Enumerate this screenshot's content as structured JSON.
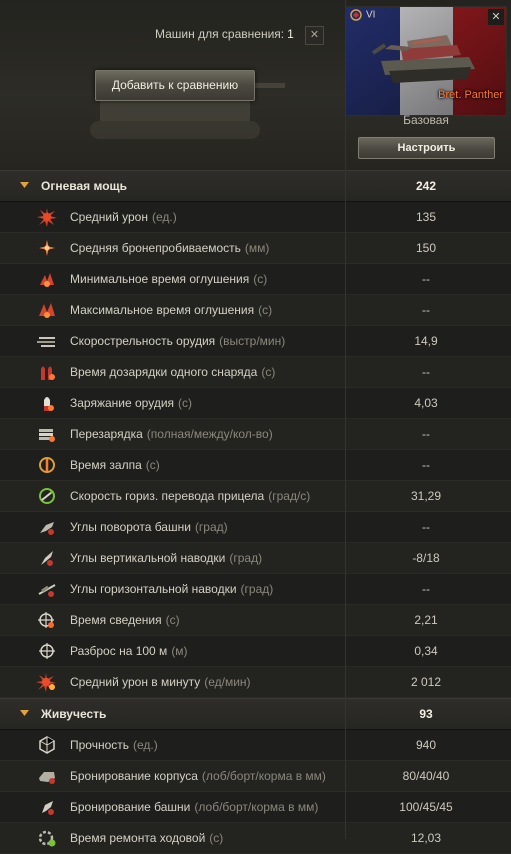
{
  "compare": {
    "count_label": "Машин для сравнения:",
    "count_value": "1",
    "add_button": "Добавить к сравнению"
  },
  "vehicle": {
    "tier": "VI",
    "name": "Bret. Panther",
    "config_label": "Базовая",
    "configure_button": "Настроить",
    "flag_colors": [
      "#28357a",
      "#e6e6ea",
      "#b21f25"
    ]
  },
  "sections": [
    {
      "title": "Огневая мощь",
      "value": "242",
      "rows": [
        {
          "icon": "damage-icon",
          "label": "Средний урон",
          "unit": "(ед.)",
          "value": "135"
        },
        {
          "icon": "penetration-icon",
          "label": "Средняя бронепробиваемость",
          "unit": "(мм)",
          "value": "150"
        },
        {
          "icon": "stun-min-icon",
          "label": "Минимальное время оглушения",
          "unit": "(с)",
          "value": "--"
        },
        {
          "icon": "stun-max-icon",
          "label": "Максимальное время оглушения",
          "unit": "(с)",
          "value": "--"
        },
        {
          "icon": "rate-of-fire-icon",
          "label": "Скорострельность орудия",
          "unit": "(выстр/мин)",
          "value": "14,9"
        },
        {
          "icon": "shell-reload-icon",
          "label": "Время дозарядки одного снаряда",
          "unit": "(с)",
          "value": "--"
        },
        {
          "icon": "reload-icon",
          "label": "Заряжание орудия",
          "unit": "(с)",
          "value": "4,03"
        },
        {
          "icon": "clip-reload-icon",
          "label": "Перезарядка",
          "unit": "(полная/между/кол-во)",
          "value": "--"
        },
        {
          "icon": "salvo-icon",
          "label": "Время залпа",
          "unit": "(с)",
          "value": "--"
        },
        {
          "icon": "traverse-speed-icon",
          "label": "Скорость гориз. перевода прицела",
          "unit": "(град/с)",
          "value": "31,29"
        },
        {
          "icon": "turret-rotation-icon",
          "label": "Углы поворота башни",
          "unit": "(град)",
          "value": "--"
        },
        {
          "icon": "gun-elevation-icon",
          "label": "Углы вертикальной наводки",
          "unit": "(град)",
          "value": "-8/18"
        },
        {
          "icon": "gun-traverse-icon",
          "label": "Углы горизонтальной наводки",
          "unit": "(град)",
          "value": "--"
        },
        {
          "icon": "aim-time-icon",
          "label": "Время сведения",
          "unit": "(с)",
          "value": "2,21"
        },
        {
          "icon": "dispersion-icon",
          "label": "Разброс на 100 м",
          "unit": "(м)",
          "value": "0,34"
        },
        {
          "icon": "dpm-icon",
          "label": "Средний урон в минуту",
          "unit": "(ед/мин)",
          "value": "2 012"
        }
      ]
    },
    {
      "title": "Живучесть",
      "value": "93",
      "rows": [
        {
          "icon": "hit-points-icon",
          "label": "Прочность",
          "unit": "(ед.)",
          "value": "940"
        },
        {
          "icon": "hull-armor-icon",
          "label": "Бронирование корпуса",
          "unit": "(лоб/борт/корма в мм)",
          "value": "80/40/40"
        },
        {
          "icon": "turret-armor-icon",
          "label": "Бронирование башни",
          "unit": "(лоб/борт/корма в мм)",
          "value": "100/45/45"
        },
        {
          "icon": "track-repair-icon",
          "label": "Время ремонта ходовой",
          "unit": "(с)",
          "value": "12,03"
        }
      ]
    }
  ]
}
